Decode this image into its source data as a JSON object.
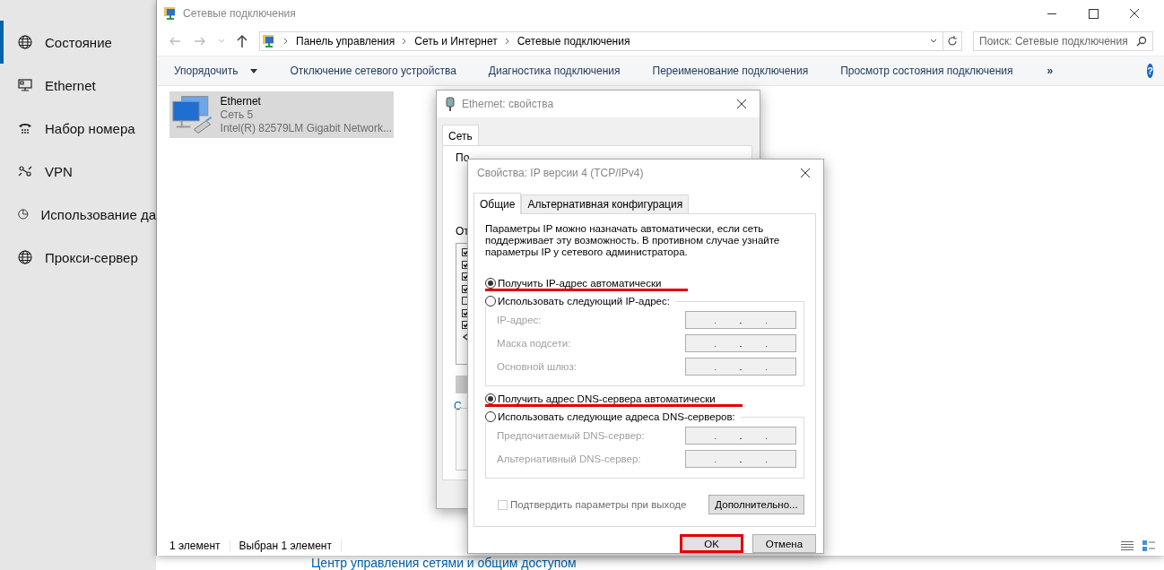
{
  "settings": {
    "nav": [
      {
        "label": "Состояние",
        "selected": true
      },
      {
        "label": "Ethernet",
        "selected": false
      },
      {
        "label": "Набор номера",
        "selected": false
      },
      {
        "label": "VPN",
        "selected": false
      },
      {
        "label": "Использование да",
        "selected": false
      },
      {
        "label": "Прокси-сервер",
        "selected": false
      }
    ],
    "link": "Центр управления сетями и общим доступом"
  },
  "explorer": {
    "title": "Сетевые подключения",
    "breadcrumb": [
      "Панель управления",
      "Сеть и Интернет",
      "Сетевые подключения"
    ],
    "search": {
      "placeholder": "Поиск: Сетевые подключения"
    },
    "commands": [
      {
        "label": "Упорядочить",
        "dropdown": true
      },
      {
        "label": "Отключение сетевого устройства",
        "dropdown": false
      },
      {
        "label": "Диагностика подключения",
        "dropdown": false
      },
      {
        "label": "Переименование подключения",
        "dropdown": false
      },
      {
        "label": "Просмотр состояния подключения",
        "dropdown": false
      }
    ],
    "overflow": "»",
    "help": "?",
    "items": [
      {
        "name": "Ethernet",
        "network": "Сеть 5",
        "adapter": "Intel(R) 82579LM Gigabit Network...",
        "selected": true
      }
    ],
    "status": [
      "1 элемент",
      "Выбран 1 элемент"
    ]
  },
  "ethernet_dialog": {
    "title": "Ethernet: свойства",
    "tabs": [
      {
        "label": "Сеть",
        "selected": true
      }
    ],
    "fragments": [
      "По",
      "От",
      "С"
    ],
    "components": [
      {
        "checked": true
      },
      {
        "checked": true
      },
      {
        "checked": true
      },
      {
        "checked": true
      },
      {
        "checked": false
      },
      {
        "checked": true
      },
      {
        "checked": true
      }
    ]
  },
  "ipv4_dialog": {
    "title": "Свойства: IP версии 4 (TCP/IPv4)",
    "tabs": [
      {
        "label": "Общие",
        "selected": true
      },
      {
        "label": "Альтернативная конфигурация",
        "selected": false
      }
    ],
    "description": "Параметры IP можно назначать автоматически, если сеть поддерживает эту возможность. В противном случае узнайте параметры IP у сетевого администратора.",
    "sections": [
      {
        "auto": {
          "label": "Получить IP-адрес автоматически",
          "selected": true,
          "highlighted": true
        },
        "manual": {
          "label": "Использовать следующий IP-адрес:",
          "selected": false
        },
        "disabled": true,
        "fields": [
          {
            "label": "IP-адрес:"
          },
          {
            "label": "Маска подсети:"
          },
          {
            "label": "Основной шлюз:"
          }
        ]
      },
      {
        "auto": {
          "label": "Получить адрес DNS-сервера автоматически",
          "selected": true,
          "highlighted": true
        },
        "manual": {
          "label": "Использовать следующие адреса DNS-серверов:",
          "selected": false
        },
        "disabled": true,
        "fields": [
          {
            "label": "Предпочитаемый DNS-сервер:"
          },
          {
            "label": "Альтернативный DNS-сервер:"
          }
        ]
      }
    ],
    "confirm": {
      "label": "Подтвердить параметры при выходе",
      "checked": false,
      "disabled": true
    },
    "advanced": "Дополнительно...",
    "buttons": [
      {
        "label": "OK",
        "highlighted": true
      },
      {
        "label": "Отмена",
        "highlighted": false
      }
    ]
  }
}
